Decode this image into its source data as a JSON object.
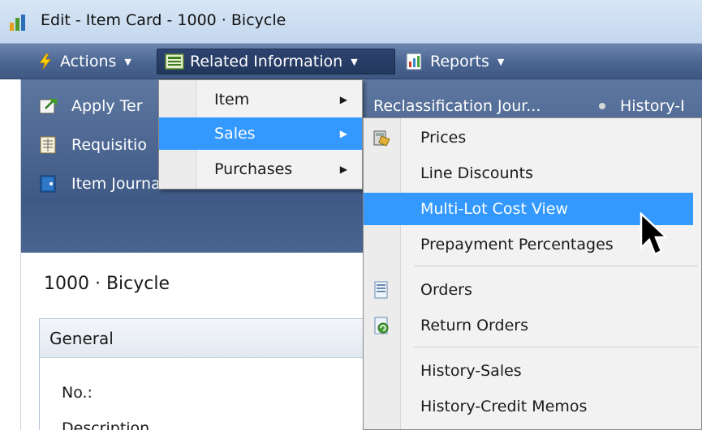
{
  "window": {
    "title": "Edit - Item Card - 1000 · Bicycle"
  },
  "command_bar": {
    "actions": "Actions",
    "related_information": "Related Information",
    "reports": "Reports"
  },
  "ribbon": {
    "apply_template": "Apply Ter",
    "requisition": "Requisitio",
    "item_journal": "Item Journal",
    "reclass_journal": "Reclassification Jour...",
    "history_partial": "History-I"
  },
  "record": {
    "heading": "1000 · Bicycle",
    "general_tab": "General",
    "no_label": "No.:",
    "description_label": "Description"
  },
  "related_menu": {
    "items": [
      "Item",
      "Sales",
      "Purchases"
    ],
    "highlighted": "Sales"
  },
  "sales_submenu": {
    "items": [
      "Prices",
      "Line Discounts",
      "Multi-Lot Cost View",
      "Prepayment Percentages",
      "Orders",
      "Return Orders",
      "History-Sales",
      "History-Credit Memos"
    ],
    "highlighted": "Multi-Lot Cost View"
  },
  "colors": {
    "highlight": "#3399ff",
    "command_bar": "#4a6591"
  }
}
